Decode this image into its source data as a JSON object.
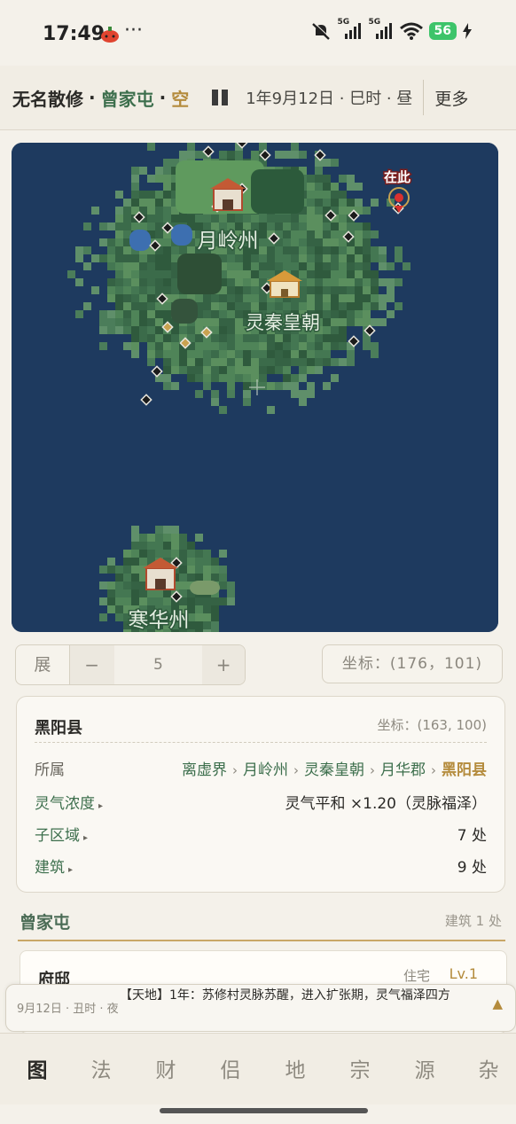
{
  "status_bar": {
    "time": "17:49",
    "more": "···",
    "network_1": "5G",
    "network_2": "5G",
    "battery": "56"
  },
  "header": {
    "player_name": "无名散修",
    "separator": "·",
    "location": "曾家屯",
    "state": "空",
    "date": "1年9月12日 · 巳时 · 昼",
    "more_label": "更多"
  },
  "map": {
    "labels": {
      "region_top": "月岭州",
      "region_mid": "灵秦皇朝",
      "region_bottom": "寒华州",
      "marker_here": "在此"
    }
  },
  "controls": {
    "expand_label": "展",
    "minus_label": "−",
    "zoom_level": "5",
    "plus_label": "+",
    "coordinate": "坐标：(176，101)"
  },
  "info": {
    "title": "黑阳县",
    "coord": "坐标：(163, 100)",
    "affiliation_label": "所属",
    "breadcrumb": [
      "离虚界",
      "月岭州",
      "灵秦皇朝",
      "月华郡",
      "黑阳县"
    ],
    "breadcrumb_arrow": "›",
    "qi_label": "灵气浓度",
    "qi_value": "灵气平和 ×1.20（灵脉福泽）",
    "subregion_label": "子区域",
    "subregion_value": "7 处",
    "building_label": "建筑",
    "building_value": "9 处",
    "expand_glyph": "▸"
  },
  "section": {
    "title": "曾家屯",
    "count": "建筑 1 处"
  },
  "building": {
    "name": "府邸",
    "type": "住宅",
    "level": "Lv.1"
  },
  "toast": {
    "time": "9月12日 · 丑时 · 夜",
    "message": "【天地】1年：苏修村灵脉苏醒，进入扩张期，灵气福泽四方",
    "toggle": "▲"
  },
  "tabs": [
    {
      "label": "图",
      "active": true
    },
    {
      "label": "法"
    },
    {
      "label": "财"
    },
    {
      "label": "侣"
    },
    {
      "label": "地"
    },
    {
      "label": "宗"
    },
    {
      "label": "源"
    },
    {
      "label": "杂"
    }
  ],
  "colors": {
    "ocean": "#1e3a5f",
    "land": "#3f6e4d",
    "accent_green": "#3d6f4d",
    "accent_gold": "#b48b3c",
    "here_marker": "#d9312f"
  }
}
